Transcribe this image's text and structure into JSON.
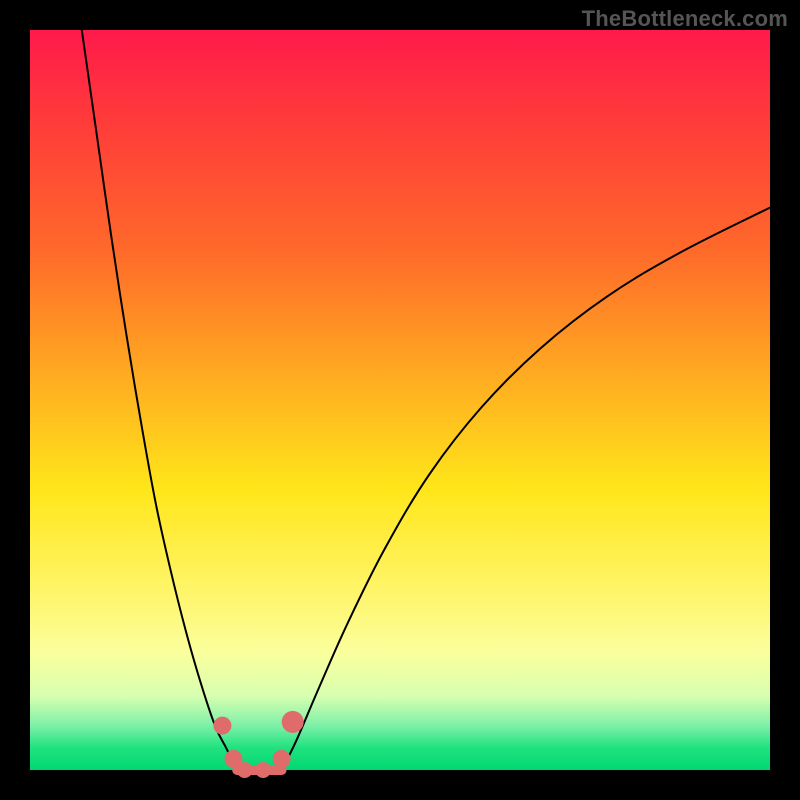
{
  "attribution": "TheBottleneck.com",
  "chart_data": {
    "type": "line",
    "title": "",
    "xlabel": "",
    "ylabel": "",
    "xlim": [
      0,
      100
    ],
    "ylim": [
      0,
      100
    ],
    "grid": false,
    "legend": false,
    "series": [
      {
        "name": "left-curve",
        "x": [
          7,
          9,
          11,
          13,
          15,
          17,
          19,
          21,
          23,
          25,
          26.5,
          28
        ],
        "y": [
          100,
          86,
          72,
          59,
          47,
          36,
          27,
          19,
          12,
          6,
          3,
          0
        ],
        "color": "#000000",
        "stroke_width": 2
      },
      {
        "name": "right-curve",
        "x": [
          34,
          36,
          39,
          43,
          48,
          54,
          61,
          69,
          78,
          88,
          100
        ],
        "y": [
          0,
          4,
          11,
          20,
          30,
          40,
          49,
          57,
          64,
          70,
          76
        ],
        "color": "#000000",
        "stroke_width": 2
      },
      {
        "name": "flat-bottom",
        "x": [
          28,
          30,
          32,
          34
        ],
        "y": [
          0,
          0,
          0,
          0
        ],
        "color": "#e06b6b",
        "stroke_width": 10
      }
    ],
    "markers": [
      {
        "name": "left-marker-high",
        "x": 26.0,
        "y": 6.0,
        "r": 9,
        "color": "#e06b6b"
      },
      {
        "name": "left-marker-low",
        "x": 27.5,
        "y": 1.5,
        "r": 9,
        "color": "#e06b6b"
      },
      {
        "name": "right-marker-high",
        "x": 35.5,
        "y": 6.5,
        "r": 11,
        "color": "#e06b6b"
      },
      {
        "name": "right-marker-low",
        "x": 34.0,
        "y": 1.5,
        "r": 9,
        "color": "#e06b6b"
      },
      {
        "name": "bottom-dot-a",
        "x": 29.0,
        "y": 0.0,
        "r": 8,
        "color": "#e06b6b"
      },
      {
        "name": "bottom-dot-b",
        "x": 31.5,
        "y": 0.0,
        "r": 8,
        "color": "#e06b6b"
      }
    ]
  }
}
